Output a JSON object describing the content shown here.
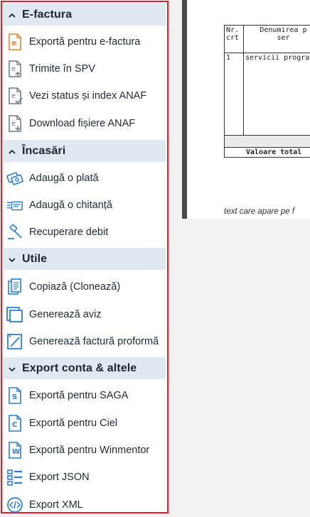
{
  "sections": [
    {
      "title": "E-factura",
      "chevron": "up",
      "items": [
        {
          "label": "Exportă pentru e-factura",
          "icon": "e-doc-icon"
        },
        {
          "label": "Trimite în SPV",
          "icon": "e-upload-icon"
        },
        {
          "label": "Vezi status și index ANAF",
          "icon": "e-check-icon"
        },
        {
          "label": "Download fișiere ANAF",
          "icon": "e-download-icon"
        }
      ]
    },
    {
      "title": "Încasări",
      "chevron": "up",
      "items": [
        {
          "label": "Adaugă o plată",
          "icon": "payment-icon"
        },
        {
          "label": "Adaugă o chitanță",
          "icon": "receipt-icon"
        },
        {
          "label": "Recuperare debit",
          "icon": "gavel-icon"
        }
      ]
    },
    {
      "title": "Utile",
      "chevron": "down",
      "items": [
        {
          "label": "Copiază (Clonează)",
          "icon": "copy-icon"
        },
        {
          "label": "Generează aviz",
          "icon": "aviz-icon"
        },
        {
          "label": "Generează factură proformă",
          "icon": "proforma-icon"
        }
      ]
    },
    {
      "title": "Export conta & altele",
      "chevron": "down",
      "items": [
        {
          "label": "Exportă pentru SAGA",
          "icon": "saga-icon",
          "letter": "S"
        },
        {
          "label": "Exportă pentru Ciel",
          "icon": "ciel-icon",
          "letter": "C"
        },
        {
          "label": "Exportă pentru Winmentor",
          "icon": "winmentor-icon",
          "letter": "W"
        },
        {
          "label": "Export JSON",
          "icon": "json-icon"
        },
        {
          "label": "Export XML",
          "icon": "xml-icon"
        }
      ]
    }
  ],
  "document": {
    "col1_header": "Nr.\ncrt",
    "col2_header": "Denumirea p\nser",
    "row_num": "1",
    "row_desc": "servicii progra",
    "total_label": "Valoare total",
    "note": "text care apare pe f"
  },
  "colors": {
    "accent": "#2a7fd4",
    "header_bg": "#dfe9f2",
    "border": "#e0202a"
  }
}
